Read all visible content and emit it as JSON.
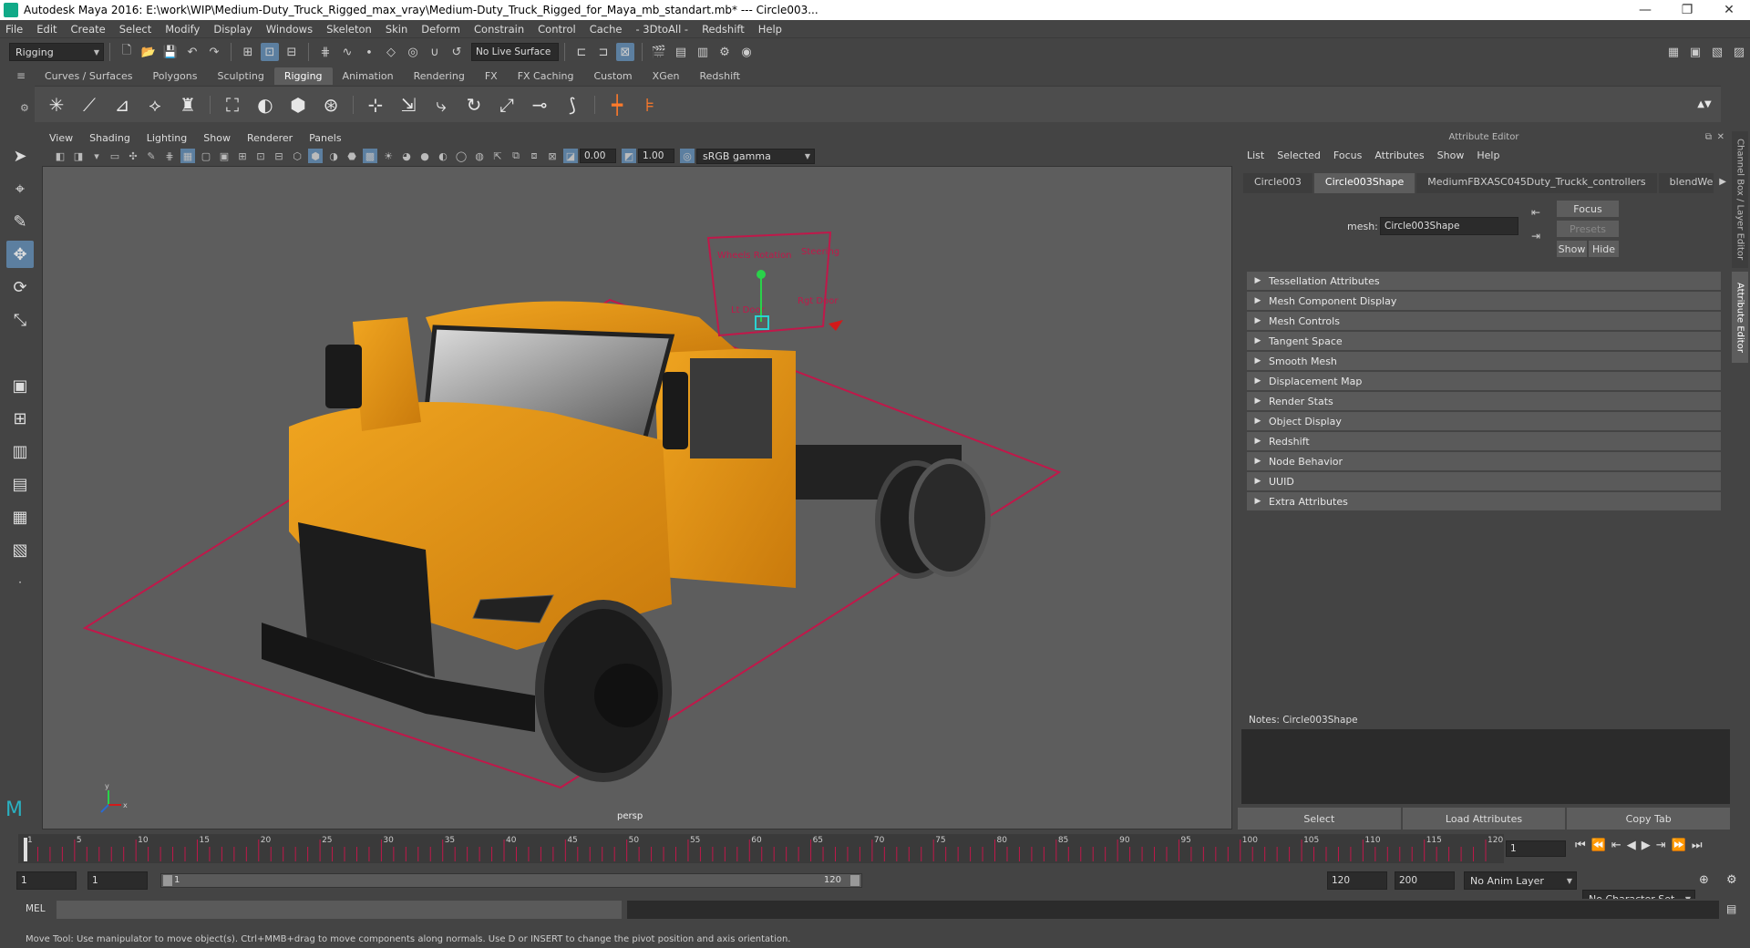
{
  "window": {
    "title": "Autodesk Maya 2016: E:\\work\\WIP\\Medium-Duty_Truck_Rigged_max_vray\\Medium-Duty_Truck_Rigged_for_Maya_mb_standart.mb*  ---  Circle003...",
    "minimize": "—",
    "restore": "❐",
    "close": "✕"
  },
  "menubar": [
    "File",
    "Edit",
    "Create",
    "Select",
    "Modify",
    "Display",
    "Windows",
    "Skeleton",
    "Skin",
    "Deform",
    "Constrain",
    "Control",
    "Cache",
    "- 3DtoAll -",
    "Redshift",
    "Help"
  ],
  "toolbar": {
    "mode_dropdown": "Rigging",
    "live_surface": "No Live Surface"
  },
  "shelf": {
    "tabs": [
      "Curves / Surfaces",
      "Polygons",
      "Sculpting",
      "Rigging",
      "Animation",
      "Rendering",
      "FX",
      "FX Caching",
      "Custom",
      "XGen",
      "Redshift"
    ],
    "active_tab": "Rigging"
  },
  "viewport": {
    "menu": [
      "View",
      "Shading",
      "Lighting",
      "Show",
      "Renderer",
      "Panels"
    ],
    "exposure": "0.00",
    "gamma": "1.00",
    "color_space": "sRGB gamma",
    "camera_label": "persp",
    "rig_labels": [
      "Wheels Rotation",
      "Steering",
      "Lt Door",
      "Rgt Door"
    ],
    "axis_labels": {
      "y": "y",
      "x": "x"
    }
  },
  "attribute_editor": {
    "header": "Attribute Editor",
    "menu": [
      "List",
      "Selected",
      "Focus",
      "Attributes",
      "Show",
      "Help"
    ],
    "tabs": [
      "Circle003",
      "Circle003Shape",
      "MediumFBXASC045Duty_Truckk_controllers",
      "blendWeighte"
    ],
    "active_tab": "Circle003Shape",
    "mesh_label": "mesh:",
    "mesh_value": "Circle003Shape",
    "buttons": {
      "focus": "Focus",
      "presets": "Presets",
      "show": "Show",
      "hide": "Hide"
    },
    "sections": [
      "Tessellation Attributes",
      "Mesh Component Display",
      "Mesh Controls",
      "Tangent Space",
      "Smooth Mesh",
      "Displacement Map",
      "Render Stats",
      "Object Display",
      "Redshift",
      "Node Behavior",
      "UUID",
      "Extra Attributes"
    ],
    "notes_label": "Notes:  Circle003Shape",
    "bottom_buttons": [
      "Select",
      "Load Attributes",
      "Copy Tab"
    ],
    "side_tabs": [
      "Channel Box / Layer Editor",
      "Attribute Editor"
    ]
  },
  "timeline": {
    "ticks": [
      "1",
      "5",
      "10",
      "15",
      "20",
      "25",
      "30",
      "35",
      "40",
      "45",
      "50",
      "55",
      "60",
      "65",
      "70",
      "75",
      "80",
      "85",
      "90",
      "95",
      "100",
      "105",
      "110",
      "115",
      "120"
    ],
    "current_frame": "1"
  },
  "range": {
    "start": "1",
    "inner_start": "1",
    "slider_start": "1",
    "slider_end": "120",
    "end": "120",
    "max": "200",
    "anim_layer": "No Anim Layer",
    "character_set": "No Character Set"
  },
  "mel": {
    "label": "MEL"
  },
  "help_line": "Move Tool: Use manipulator to move object(s). Ctrl+MMB+drag to move components along normals. Use D or INSERT to change the pivot position and axis orientation.",
  "colors": {
    "accent": "#5c7fa0",
    "truck_body": "#e8a020",
    "control_curve": "#c0184a"
  }
}
